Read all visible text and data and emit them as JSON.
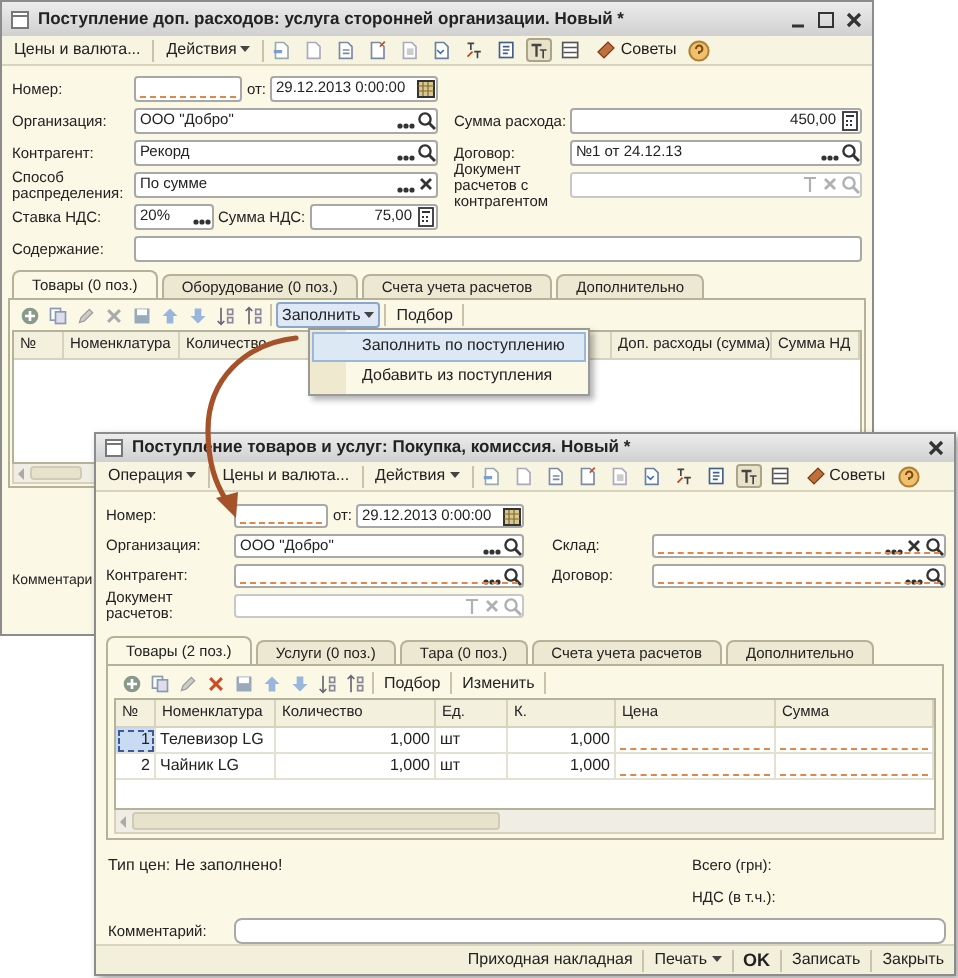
{
  "back_window": {
    "title": "Поступление доп. расходов: услуга сторонней организации. Новый *",
    "toolbar": {
      "buttons": [
        {
          "label": "Цены и валюта...",
          "menu": false
        },
        {
          "label": "Действия",
          "menu": true
        }
      ],
      "tips": "Советы"
    },
    "form": [
      {
        "kind": "single",
        "label": "Номер:",
        "items": [
          {
            "kind": "text",
            "required": true
          },
          {
            "kind": "label",
            "text": "от:"
          },
          {
            "kind": "date",
            "value": "29.12.2013  0:00:00"
          }
        ]
      },
      {
        "kind": "pair",
        "label": "Организация:",
        "items": [
          {
            "kind": "reference",
            "value": "ООО \"Добро\""
          }
        ],
        "right_label": "Сумма расхода:",
        "right_items": [
          {
            "kind": "number",
            "value": "450,00"
          }
        ]
      },
      {
        "kind": "pair",
        "label": "Контрагент:",
        "items": [
          {
            "kind": "reference",
            "value": "Рекорд"
          }
        ],
        "right_label": "Договор:",
        "right_items": [
          {
            "kind": "reference",
            "value": "№1 от 24.12.13"
          }
        ]
      },
      {
        "kind": "pair",
        "label": "Способ распределения:",
        "items": [
          {
            "kind": "choice",
            "value": "По сумме"
          }
        ],
        "right_label": "Документ расчетов с контрагентом",
        "right_items": [
          {
            "kind": "composite",
            "disabled": true
          }
        ]
      },
      {
        "kind": "single",
        "label": "Ставка НДС:",
        "items": [
          {
            "kind": "select",
            "value": "20%"
          },
          {
            "kind": "label",
            "text": "Сумма НДС:"
          },
          {
            "kind": "number",
            "value": "75,00"
          }
        ]
      },
      {
        "kind": "wide",
        "label": "Содержание:",
        "items": [
          {
            "kind": "text"
          }
        ]
      }
    ],
    "tabs": [
      {
        "label": "Товары (0 поз.)",
        "selected": true
      },
      {
        "label": "Оборудование (0 поз.)",
        "selected": false
      },
      {
        "label": "Счета учета расчетов",
        "selected": false
      },
      {
        "label": "Дополнительно",
        "selected": false
      }
    ],
    "table_toolbar": {
      "buttons": [
        {
          "label": "Заполнить",
          "menu": true,
          "pressed": true
        },
        {
          "label": "Подбор",
          "menu": false,
          "pressed": false
        }
      ]
    },
    "table": {
      "columns": [
        "№",
        "Номенклатура",
        "Количество",
        "Доп. расходы (сумма)",
        "Сумма НД"
      ]
    },
    "dropdown": {
      "items": [
        {
          "label": "Заполнить по поступлению",
          "selected": true
        },
        {
          "label": "Добавить из поступления",
          "selected": false
        }
      ]
    },
    "comment_label": "Комментари"
  },
  "front_window": {
    "title": "Поступление товаров и услуг: Покупка, комиссия. Новый *",
    "toolbar": {
      "buttons": [
        {
          "label": "Операция",
          "menu": true
        },
        {
          "label": "Цены и валюта...",
          "menu": false
        },
        {
          "label": "Действия",
          "menu": true
        }
      ],
      "tips": "Советы"
    },
    "form": [
      {
        "kind": "single",
        "label": "Номер:",
        "items": [
          {
            "kind": "text",
            "required": true
          },
          {
            "kind": "label",
            "text": "от:"
          },
          {
            "kind": "date",
            "value": "29.12.2013  0:00:00"
          }
        ]
      },
      {
        "kind": "pair",
        "label": "Организация:",
        "items": [
          {
            "kind": "reference",
            "value": "ООО \"Добро\""
          }
        ],
        "right_label": "Склад:",
        "right_items": [
          {
            "kind": "reference_clearable",
            "required": true
          }
        ]
      },
      {
        "kind": "pair",
        "label": "Контрагент:",
        "items": [
          {
            "kind": "reference",
            "required": true
          }
        ],
        "right_label": "Договор:",
        "right_items": [
          {
            "kind": "reference",
            "required": true
          }
        ]
      },
      {
        "kind": "single",
        "label": "Документ расчетов:",
        "items": [
          {
            "kind": "composite",
            "disabled": true
          }
        ]
      }
    ],
    "tabs": [
      {
        "label": "Товары (2 поз.)",
        "selected": true
      },
      {
        "label": "Услуги (0 поз.)",
        "selected": false
      },
      {
        "label": "Тара (0 поз.)",
        "selected": false
      },
      {
        "label": "Счета учета расчетов",
        "selected": false
      },
      {
        "label": "Дополнительно",
        "selected": false
      }
    ],
    "table_toolbar": {
      "buttons": [
        {
          "label": "Подбор",
          "menu": false,
          "pressed": false
        },
        {
          "label": "Изменить",
          "menu": false,
          "pressed": false
        }
      ]
    },
    "table": {
      "columns": [
        "№",
        "Номенклатура",
        "Количество",
        "Ед.",
        "К.",
        "Цена",
        "Сумма"
      ],
      "rows": [
        {
          "cells": [
            "1",
            "Телевизор LG",
            "1,000",
            "шт",
            "1,000"
          ],
          "price_missing": true,
          "selected": true
        },
        {
          "cells": [
            "2",
            "Чайник LG",
            "1,000",
            "шт",
            "1,000"
          ],
          "price_missing": true,
          "selected": false
        }
      ]
    },
    "price_type": "Тип цен: Не заполнено!",
    "totals": [
      "Всего (грн):",
      "НДС (в т.ч.):"
    ],
    "comment_label": "Комментарий:",
    "bottom_buttons": [
      {
        "label": "Приходная накладная",
        "menu": false,
        "default": false
      },
      {
        "label": "Печать",
        "menu": true,
        "default": false
      },
      {
        "label": "OK",
        "menu": false,
        "default": true
      },
      {
        "label": "Записать",
        "menu": false,
        "default": false
      },
      {
        "label": "Закрыть",
        "menu": false,
        "default": false
      }
    ]
  }
}
